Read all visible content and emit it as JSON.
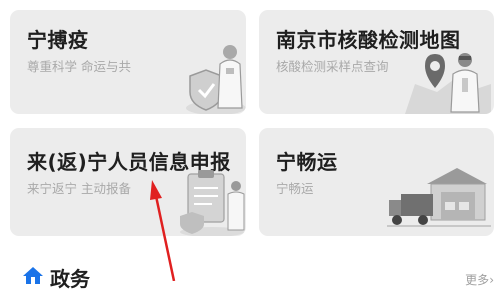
{
  "cards": [
    {
      "title": "宁搏疫",
      "subtitle": "尊重科学 命运与共"
    },
    {
      "title": "南京市核酸检测地图",
      "subtitle": "核酸检测采样点查询"
    },
    {
      "title": "来(返)宁人员信息申报",
      "subtitle": "来宁返宁 主动报备"
    },
    {
      "title": "宁畅运",
      "subtitle": "宁畅运"
    }
  ],
  "section": {
    "title": "政务",
    "more": "更多"
  },
  "icons": {
    "card1": "doctor-shield-icon",
    "card2": "map-pin-doctor-icon",
    "card3": "clipboard-doctor-icon",
    "card4": "truck-warehouse-icon",
    "section": "home-icon",
    "more": "chevron-right-icon",
    "annotation": "red-arrow"
  },
  "colors": {
    "card_bg": "#ececec",
    "title": "#1f1f1f",
    "subtitle": "#a9a9a9",
    "accent": "#1a73e8",
    "annotation": "#e02020"
  }
}
